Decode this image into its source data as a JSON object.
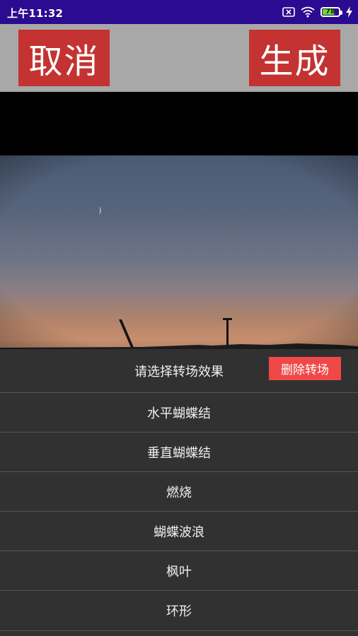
{
  "status_bar": {
    "time": "上午11:32",
    "battery_level": "78",
    "battery_fraction": 0.78,
    "icons": [
      "sim-off-icon",
      "wifi-icon",
      "battery-icon",
      "charging-icon"
    ]
  },
  "toolbar": {
    "cancel_label": "取消",
    "generate_label": "生成",
    "button_color": "#c43232",
    "background_color": "#a8a8a8"
  },
  "sheet": {
    "title": "请选择转场效果",
    "delete_label": "删除转场",
    "delete_color": "#f04848",
    "options": [
      {
        "label": "水平蝴蝶结"
      },
      {
        "label": "垂直蝴蝶结"
      },
      {
        "label": "燃烧"
      },
      {
        "label": "蝴蝶波浪"
      },
      {
        "label": "枫叶"
      },
      {
        "label": "环形"
      }
    ]
  }
}
